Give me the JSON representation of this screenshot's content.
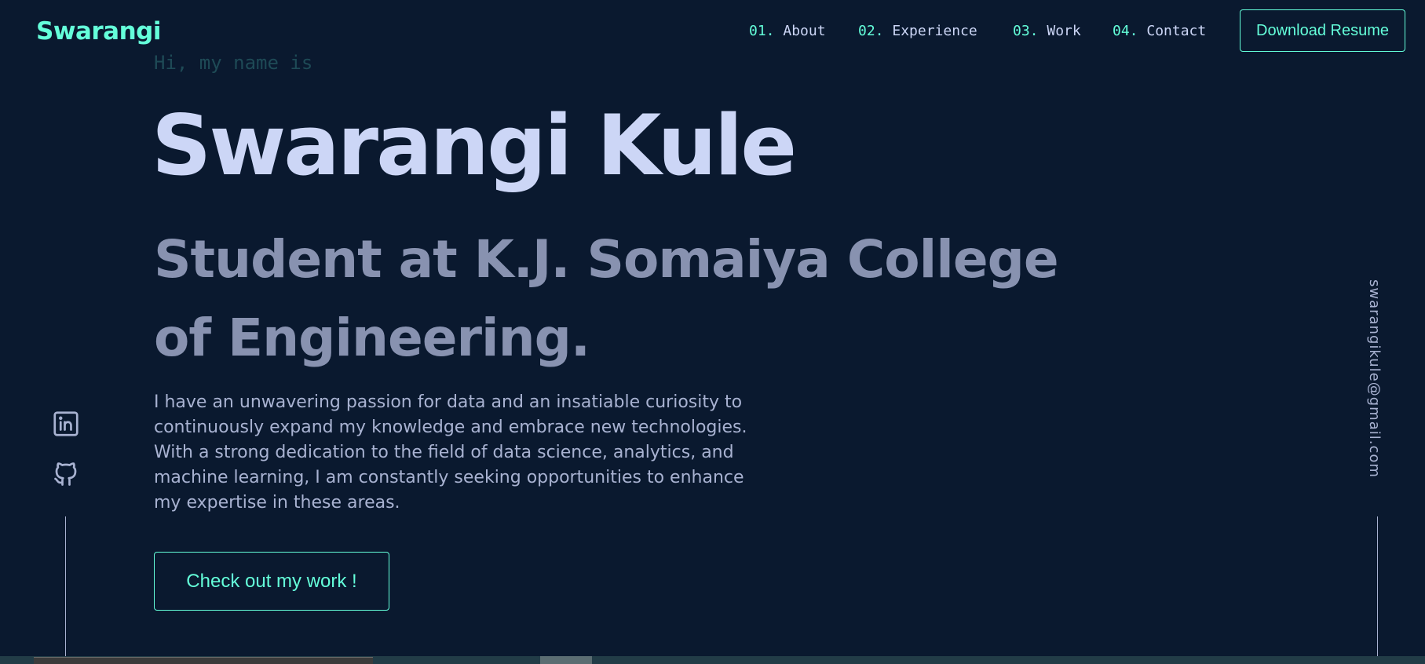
{
  "header": {
    "logo": "Swarangi",
    "nav": [
      {
        "num": "01.",
        "label": "About"
      },
      {
        "num": "02.",
        "label": "Experience"
      },
      {
        "num": "03.",
        "label": "Work"
      },
      {
        "num": "04.",
        "label": "Contact"
      }
    ],
    "resume_label": "Download Resume"
  },
  "hero": {
    "greeting": "Hi, my name is",
    "name": "Swarangi Kule",
    "subtitle": "Student at K.J. Somaiya College of Engineering.",
    "description": "I have an unwavering passion for data and an insatiable curiosity to continuously expand my knowledge and embrace new technologies. With a strong dedication to the field of data science, analytics, and machine learning, I am constantly seeking opportunities to enhance my expertise in these areas.",
    "cta_label": "Check out my work !"
  },
  "social": {
    "icons": [
      "linkedin-icon",
      "github-icon"
    ]
  },
  "email": "swarangikule@gmail.com",
  "colors": {
    "background": "#0a192f",
    "accent": "#64ffda",
    "heading": "#ccd6f6",
    "subheading": "#8892b0",
    "body": "#a8b2d1"
  }
}
